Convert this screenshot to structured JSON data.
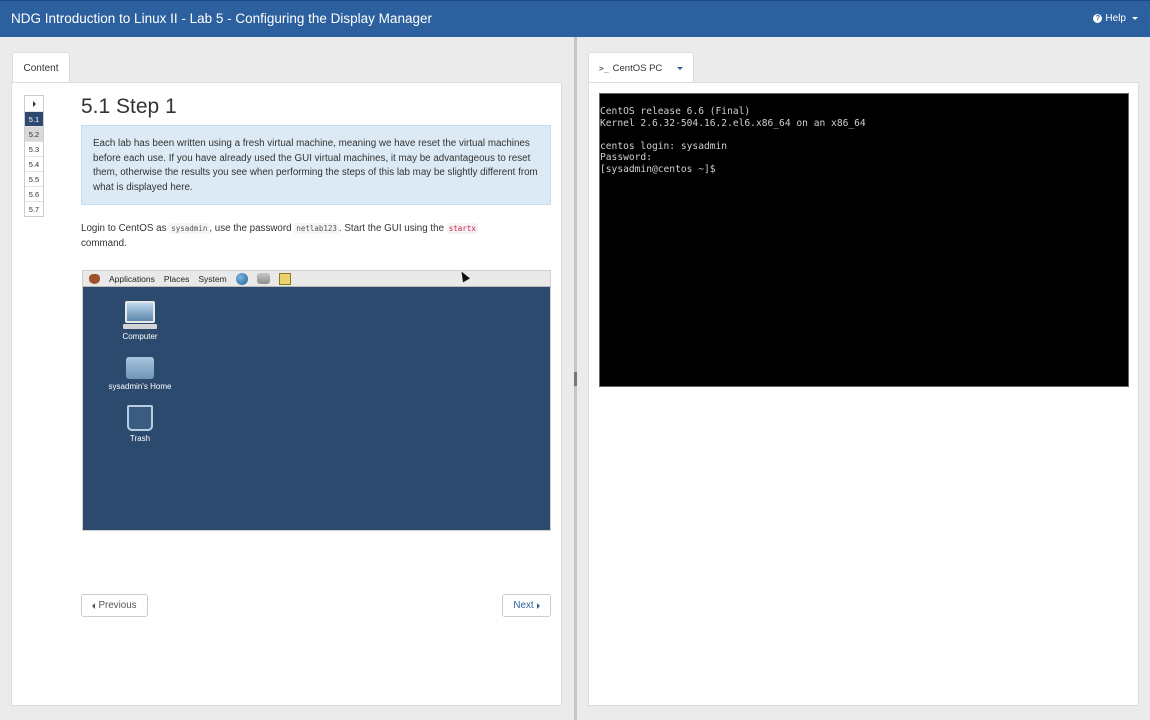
{
  "header": {
    "title": "NDG Introduction to Linux II - Lab 5 - Configuring the Display Manager",
    "help_label": "Help"
  },
  "left": {
    "tab_label": "Content",
    "step_nav": [
      "5.1",
      "5.2",
      "5.3",
      "5.4",
      "5.5",
      "5.6",
      "5.7"
    ],
    "active_step": "5.1",
    "step_title": "5.1 Step 1",
    "note": "Each lab has been written using a fresh virtual machine, meaning we have reset the virtual machines before each use. If you have already used the GUI virtual machines, it may be advantageous to reset them, otherwise the results you see when performing the steps of this lab may be slightly different from what is displayed here.",
    "instr": {
      "part1": "Login to CentOS as ",
      "user": "sysadmin",
      "part2": ", use the password ",
      "password": "netlab123",
      "part3": ". Start the GUI using the ",
      "command": "startx",
      "part4": " command."
    },
    "screenshot": {
      "menu_items": [
        "Applications",
        "Places",
        "System"
      ],
      "icons": [
        {
          "label": "Computer",
          "icon": "computer-icon"
        },
        {
          "label": "sysadmin's Home",
          "icon": "home-folder-icon"
        },
        {
          "label": "Trash",
          "icon": "trash-icon"
        }
      ]
    },
    "prev_label": "Previous",
    "next_label": "Next"
  },
  "right": {
    "tab_label": "CentOS PC",
    "terminal_text": "CentOS release 6.6 (Final)\nKernel 2.6.32-504.16.2.el6.x86_64 on an x86_64\n\ncentos login: sysadmin\nPassword:\n[sysadmin@centos ~]$"
  },
  "colors": {
    "header_bg": "#2d609e",
    "active_step_bg": "#2d4a6e",
    "note_bg": "#dbeaf5",
    "desktop_bg": "#2c4a6d",
    "terminal_bg": "#000000"
  }
}
